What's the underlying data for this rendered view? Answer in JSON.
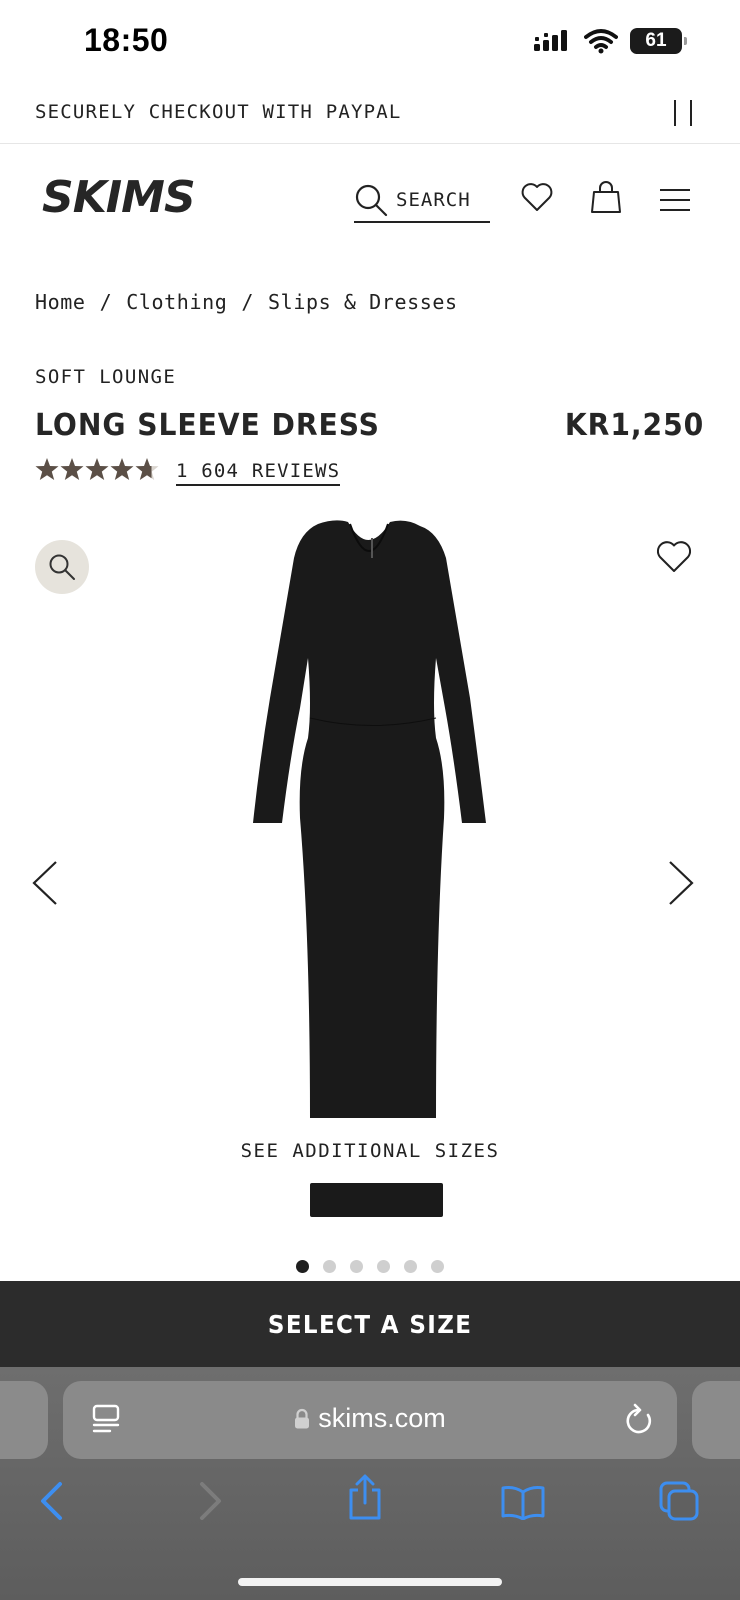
{
  "status_bar": {
    "time": "18:50",
    "battery": "61"
  },
  "promo": {
    "text": "SECURELY CHECKOUT WITH PAYPAL"
  },
  "header": {
    "brand": "SKIMS",
    "search_label": "SEARCH"
  },
  "breadcrumb": {
    "items": [
      "Home",
      "/",
      "Clothing",
      "/",
      "Slips & Dresses"
    ]
  },
  "product": {
    "collection": "SOFT LOUNGE",
    "title": "LONG SLEEVE DRESS",
    "price": "KR1,250",
    "rating": 4.7,
    "reviews": "1 604 REVIEWS",
    "see_sizes": "SEE ADDITIONAL SIZES",
    "image_count": 6,
    "active_image": 1
  },
  "cta": {
    "label": "SELECT A SIZE"
  },
  "browser": {
    "url": "skims.com"
  },
  "colors": {
    "ink": "#1f1f1f",
    "cta_bg": "#2c2c2c",
    "zoom_bg": "#e6e3dc",
    "star": "#5b4f46",
    "safari_blue": "#3d8ef0"
  }
}
